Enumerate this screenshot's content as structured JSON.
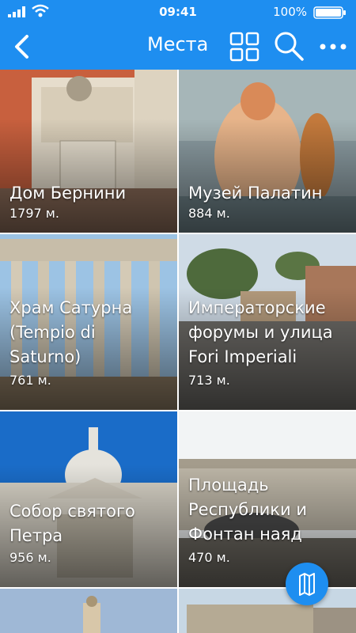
{
  "status": {
    "time": "09:41",
    "battery": "100%"
  },
  "nav": {
    "title": "Места"
  },
  "places": [
    {
      "name": "Дом Бернини",
      "distance": "1797 м."
    },
    {
      "name": "Музей Палатин",
      "distance": "884 м."
    },
    {
      "name": "Храм Сатурна (Tempio di Saturno)",
      "distance": "761 м."
    },
    {
      "name": "Императорские форумы и улица Fori Imperiali",
      "distance": "713 м."
    },
    {
      "name": "Собор святого Петра",
      "distance": "956 м."
    },
    {
      "name": "Площадь Республики и Фонтан наяд",
      "distance": "470 м."
    }
  ],
  "icons": {
    "back": "chevron-left-icon",
    "grid": "grid-view-icon",
    "search": "search-icon",
    "more": "more-dots-icon",
    "map": "map-icon"
  },
  "colors": {
    "accent": "#1e8ef0",
    "text": "#ffffff"
  }
}
